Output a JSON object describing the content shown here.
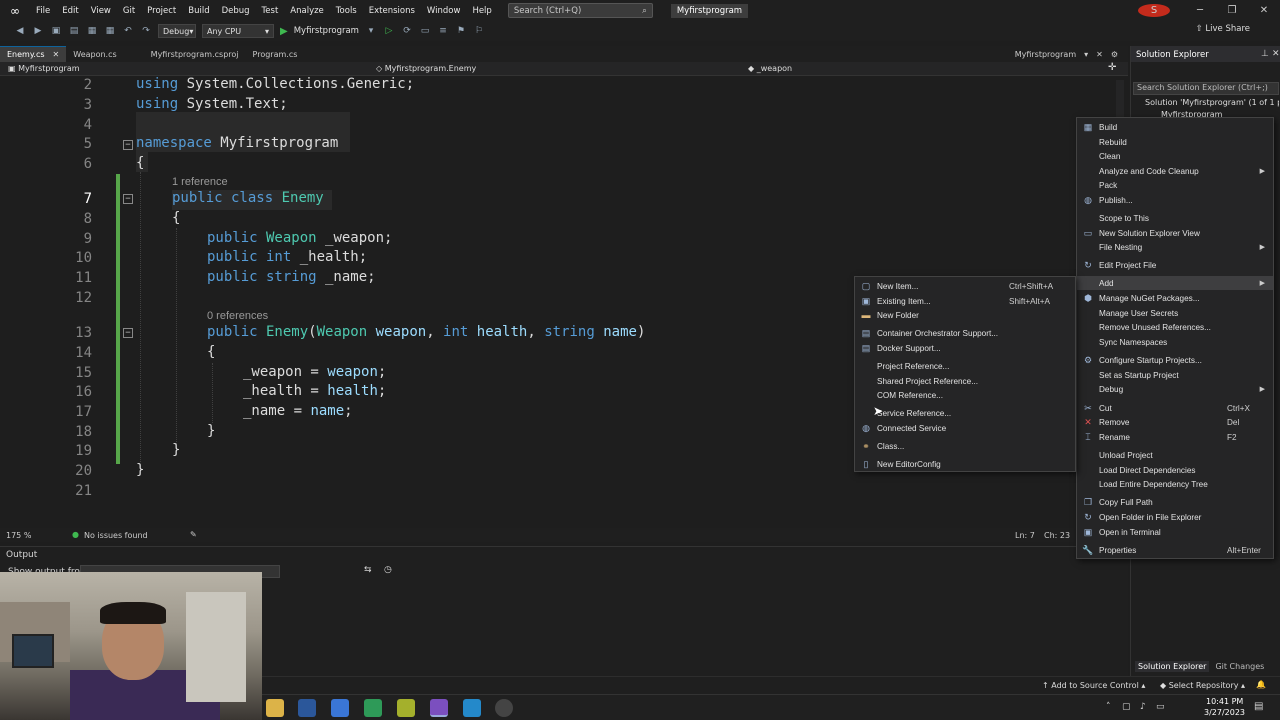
{
  "menubar": {
    "items": [
      "File",
      "Edit",
      "View",
      "Git",
      "Project",
      "Build",
      "Debug",
      "Test",
      "Analyze",
      "Tools",
      "Extensions",
      "Window",
      "Help"
    ],
    "search_placeholder": "Search (Ctrl+Q)",
    "project_name": "Myfirstprogram",
    "avatar_letter": "S"
  },
  "toolbar": {
    "config": "Debug",
    "platform": "Any CPU",
    "run_target": "Myfirstprogram",
    "live_share": "Live Share"
  },
  "tabs": [
    {
      "label": "Enemy.cs",
      "active": true
    },
    {
      "label": "Weapon.cs",
      "active": false
    },
    {
      "label": "Myfirstprogram.csproj",
      "active": false
    },
    {
      "label": "Program.cs",
      "active": false
    }
  ],
  "tab_right_label": "Myfirstprogram",
  "navbar": {
    "project": "Myfirstprogram",
    "type": "Myfirstprogram.Enemy",
    "member": "_weapon"
  },
  "editor": {
    "line_numbers": [
      "2",
      "3",
      "4",
      "5",
      "6",
      "7",
      "8",
      "9",
      "10",
      "11",
      "12",
      "13",
      "14",
      "15",
      "16",
      "17",
      "18",
      "19",
      "20",
      "21"
    ],
    "current_line": "7",
    "hint_1": "1 reference",
    "hint_2": "0 references",
    "lines": {
      "l2_kw": "using",
      "l2_rest": " System.Collections.Generic;",
      "l3_kw": "using",
      "l3_rest": " System.Text;",
      "l5_kw": "namespace",
      "l5_rest": " Myfirstprogram",
      "l6": "{",
      "l7_kw": "public class",
      "l7_ty": " Enemy",
      "l8": "{",
      "l9_kw": "public",
      "l9_ty": " Weapon",
      "l9_rest": " _weapon;",
      "l10_kw": "public int",
      "l10_rest": " _health;",
      "l11_kw": "public string",
      "l11_rest": " _name;",
      "l13_kw": "public",
      "l13_ty": " Enemy",
      "l13_p1": "(",
      "l13_t2": "Weapon",
      "l13_p2": " weapon",
      "l13_c1": ", ",
      "l13_k2": "int",
      "l13_p3": " health",
      "l13_c2": ", ",
      "l13_k3": "string",
      "l13_p4": " name",
      "l13_end": ")",
      "l14": "{",
      "l15_a": "_weapon = ",
      "l15_b": "weapon",
      "l15_c": ";",
      "l16_a": "_health = ",
      "l16_b": "health",
      "l16_c": ";",
      "l17_a": "_name = ",
      "l17_b": "name",
      "l17_c": ";",
      "l18": "}",
      "l19": "}",
      "l20": "}"
    }
  },
  "editor_status": {
    "zoom": "175 %",
    "issues": "No issues found",
    "line": "Ln: 7",
    "col": "Ch: 23"
  },
  "output": {
    "title": "Output",
    "show_from": "Show output from:"
  },
  "solution_explorer": {
    "title": "Solution Explorer",
    "search_placeholder": "Search Solution Explorer (Ctrl+;)",
    "solution_line": "Solution 'Myfirstprogram' (1 of 1 p",
    "project_line": "Myfirstprogram",
    "bottom_tabs": [
      "Solution Explorer",
      "Git Changes"
    ]
  },
  "context_menu": [
    {
      "label": "Build",
      "icon": "build-icon",
      "shortcut": "",
      "sub": false
    },
    {
      "label": "Rebuild",
      "icon": "",
      "shortcut": "",
      "sub": false
    },
    {
      "label": "Clean",
      "icon": "",
      "shortcut": "",
      "sub": false
    },
    {
      "label": "Analyze and Code Cleanup",
      "icon": "",
      "shortcut": "",
      "sub": true
    },
    {
      "label": "Pack",
      "icon": "",
      "shortcut": "",
      "sub": false
    },
    {
      "label": "Publish...",
      "icon": "globe-icon",
      "shortcut": "",
      "sub": false
    },
    {
      "label": "Scope to This",
      "icon": "",
      "shortcut": "",
      "sub": false
    },
    {
      "label": "New Solution Explorer View",
      "icon": "window-icon",
      "shortcut": "",
      "sub": false
    },
    {
      "label": "File Nesting",
      "icon": "",
      "shortcut": "",
      "sub": true
    },
    {
      "label": "Edit Project File",
      "icon": "refresh-icon",
      "shortcut": "",
      "sub": false
    },
    {
      "label": "Add",
      "icon": "",
      "shortcut": "",
      "sub": true
    },
    {
      "label": "Manage NuGet Packages...",
      "icon": "nuget-icon",
      "shortcut": "",
      "sub": false
    },
    {
      "label": "Manage User Secrets",
      "icon": "",
      "shortcut": "",
      "sub": false
    },
    {
      "label": "Remove Unused References...",
      "icon": "",
      "shortcut": "",
      "sub": false
    },
    {
      "label": "Sync Namespaces",
      "icon": "",
      "shortcut": "",
      "sub": false
    },
    {
      "label": "Configure Startup Projects...",
      "icon": "gear-icon",
      "shortcut": "",
      "sub": false
    },
    {
      "label": "Set as Startup Project",
      "icon": "",
      "shortcut": "",
      "sub": false
    },
    {
      "label": "Debug",
      "icon": "",
      "shortcut": "",
      "sub": true
    },
    {
      "label": "Cut",
      "icon": "scissors-icon",
      "shortcut": "Ctrl+X",
      "sub": false
    },
    {
      "label": "Remove",
      "icon": "x-icon",
      "shortcut": "Del",
      "sub": false
    },
    {
      "label": "Rename",
      "icon": "rename-icon",
      "shortcut": "F2",
      "sub": false
    },
    {
      "label": "Unload Project",
      "icon": "",
      "shortcut": "",
      "sub": false
    },
    {
      "label": "Load Direct Dependencies",
      "icon": "",
      "shortcut": "",
      "sub": false
    },
    {
      "label": "Load Entire Dependency Tree",
      "icon": "",
      "shortcut": "",
      "sub": false
    },
    {
      "label": "Copy Full Path",
      "icon": "copy-icon",
      "shortcut": "",
      "sub": false
    },
    {
      "label": "Open Folder in File Explorer",
      "icon": "refresh-icon",
      "shortcut": "",
      "sub": false
    },
    {
      "label": "Open in Terminal",
      "icon": "terminal-icon",
      "shortcut": "",
      "sub": false
    },
    {
      "label": "Properties",
      "icon": "wrench-icon",
      "shortcut": "Alt+Enter",
      "sub": false
    }
  ],
  "add_submenu": [
    {
      "label": "New Item...",
      "icon": "new-item-icon",
      "shortcut": "Ctrl+Shift+A"
    },
    {
      "label": "Existing Item...",
      "icon": "existing-item-icon",
      "shortcut": "Shift+Alt+A"
    },
    {
      "label": "New Folder",
      "icon": "folder-icon",
      "shortcut": ""
    },
    {
      "label": "Container Orchestrator Support...",
      "icon": "container-icon",
      "shortcut": ""
    },
    {
      "label": "Docker Support...",
      "icon": "docker-icon",
      "shortcut": ""
    },
    {
      "label": "Project Reference...",
      "icon": "",
      "shortcut": ""
    },
    {
      "label": "Shared Project Reference...",
      "icon": "",
      "shortcut": ""
    },
    {
      "label": "COM Reference...",
      "icon": "",
      "shortcut": ""
    },
    {
      "label": "Service Reference...",
      "icon": "",
      "shortcut": ""
    },
    {
      "label": "Connected Service",
      "icon": "connected-service-icon",
      "shortcut": ""
    },
    {
      "label": "Class...",
      "icon": "class-icon",
      "shortcut": ""
    },
    {
      "label": "New EditorConfig",
      "icon": "editorconfig-icon",
      "shortcut": ""
    }
  ],
  "statusbar": {
    "source_control": "Add to Source Control",
    "repository": "Select Repository"
  },
  "clock": {
    "time": "10:41 PM",
    "date": "3/27/2023"
  },
  "colors": {
    "accent": "#0e639c",
    "keyword": "#569cd6",
    "type": "#4ec9b0",
    "param": "#9cdcfe",
    "change_bar": "#57a64a",
    "vs_purple": "#7b4fbf"
  }
}
